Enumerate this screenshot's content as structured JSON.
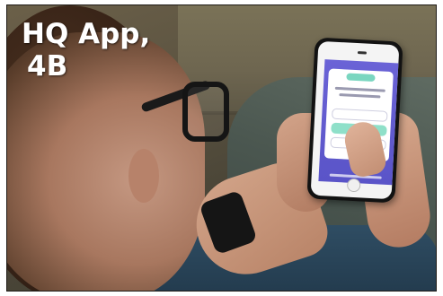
{
  "caption": {
    "line1": "HQ App,",
    "line2": "4B"
  }
}
